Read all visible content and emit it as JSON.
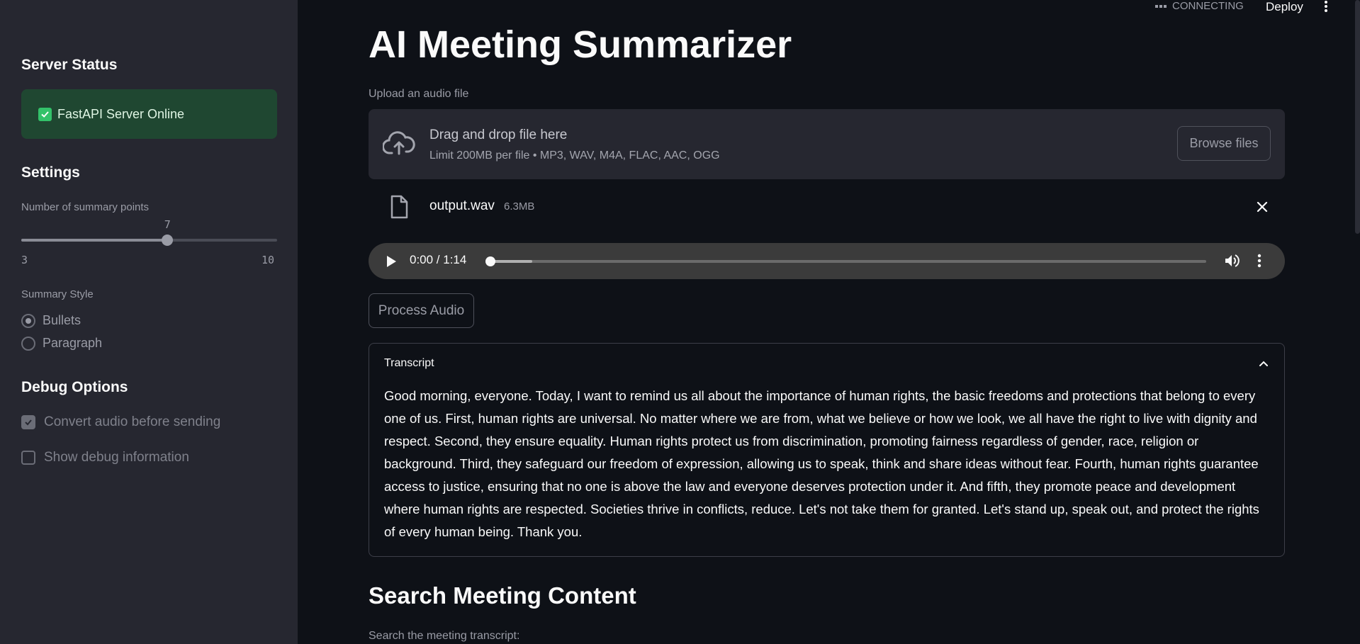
{
  "header": {
    "connection_status": "CONNECTING",
    "deploy_label": "Deploy"
  },
  "sidebar": {
    "server_status_heading": "Server Status",
    "server_status_text": "FastAPI Server Online",
    "settings_heading": "Settings",
    "summary_points_label": "Number of summary points",
    "summary_points": {
      "value": 7,
      "min": 3,
      "max": 10,
      "value_text": "7",
      "min_text": "3",
      "max_text": "10"
    },
    "summary_style_label": "Summary Style",
    "summary_style_options": [
      "Bullets",
      "Paragraph"
    ],
    "summary_style_selected": "Bullets",
    "debug_heading": "Debug Options",
    "convert_audio_label": "Convert audio before sending",
    "convert_audio_checked": true,
    "show_debug_label": "Show debug information",
    "show_debug_checked": false
  },
  "main": {
    "title": "AI Meeting Summarizer",
    "upload_label": "Upload an audio file",
    "dropzone_title": "Drag and drop file here",
    "dropzone_limit": "Limit 200MB per file • MP3, WAV, M4A, FLAC, AAC, OGG",
    "browse_label": "Browse files",
    "file": {
      "name": "output.wav",
      "size": "6.3MB"
    },
    "player": {
      "time": "0:00 / 1:14",
      "buffered_fraction": 0.06
    },
    "process_label": "Process Audio",
    "transcript_title": "Transcript",
    "transcript_text": "Good morning, everyone. Today, I want to remind us all about the importance of human rights, the basic freedoms and protections that belong to every one of us. First, human rights are universal. No matter where we are from, what we believe or how we look, we all have the right to live with dignity and respect. Second, they ensure equality. Human rights protect us from discrimination, promoting fairness regardless of gender, race, religion or background. Third, they safeguard our freedom of expression, allowing us to speak, think and share ideas without fear. Fourth, human rights guarantee access to justice, ensuring that no one is above the law and everyone deserves protection under it. And fifth, they promote peace and development where human rights are respected. Societies thrive in conflicts, reduce. Let's not take them for granted. Let's stand up, speak out, and protect the rights of every human being. Thank you.",
    "search_heading": "Search Meeting Content",
    "search_label": "Search the meeting transcript:"
  },
  "colors": {
    "accent_green": "#33c26a",
    "status_bg": "#1f4731",
    "background": "#0e1117",
    "sidebar_bg": "#262730"
  },
  "icons": [
    "check-icon",
    "upload-cloud-icon",
    "file-icon",
    "close-icon",
    "play-icon",
    "volume-icon",
    "more-vertical-icon",
    "chevron-up-icon",
    "menu-kebab-icon"
  ]
}
